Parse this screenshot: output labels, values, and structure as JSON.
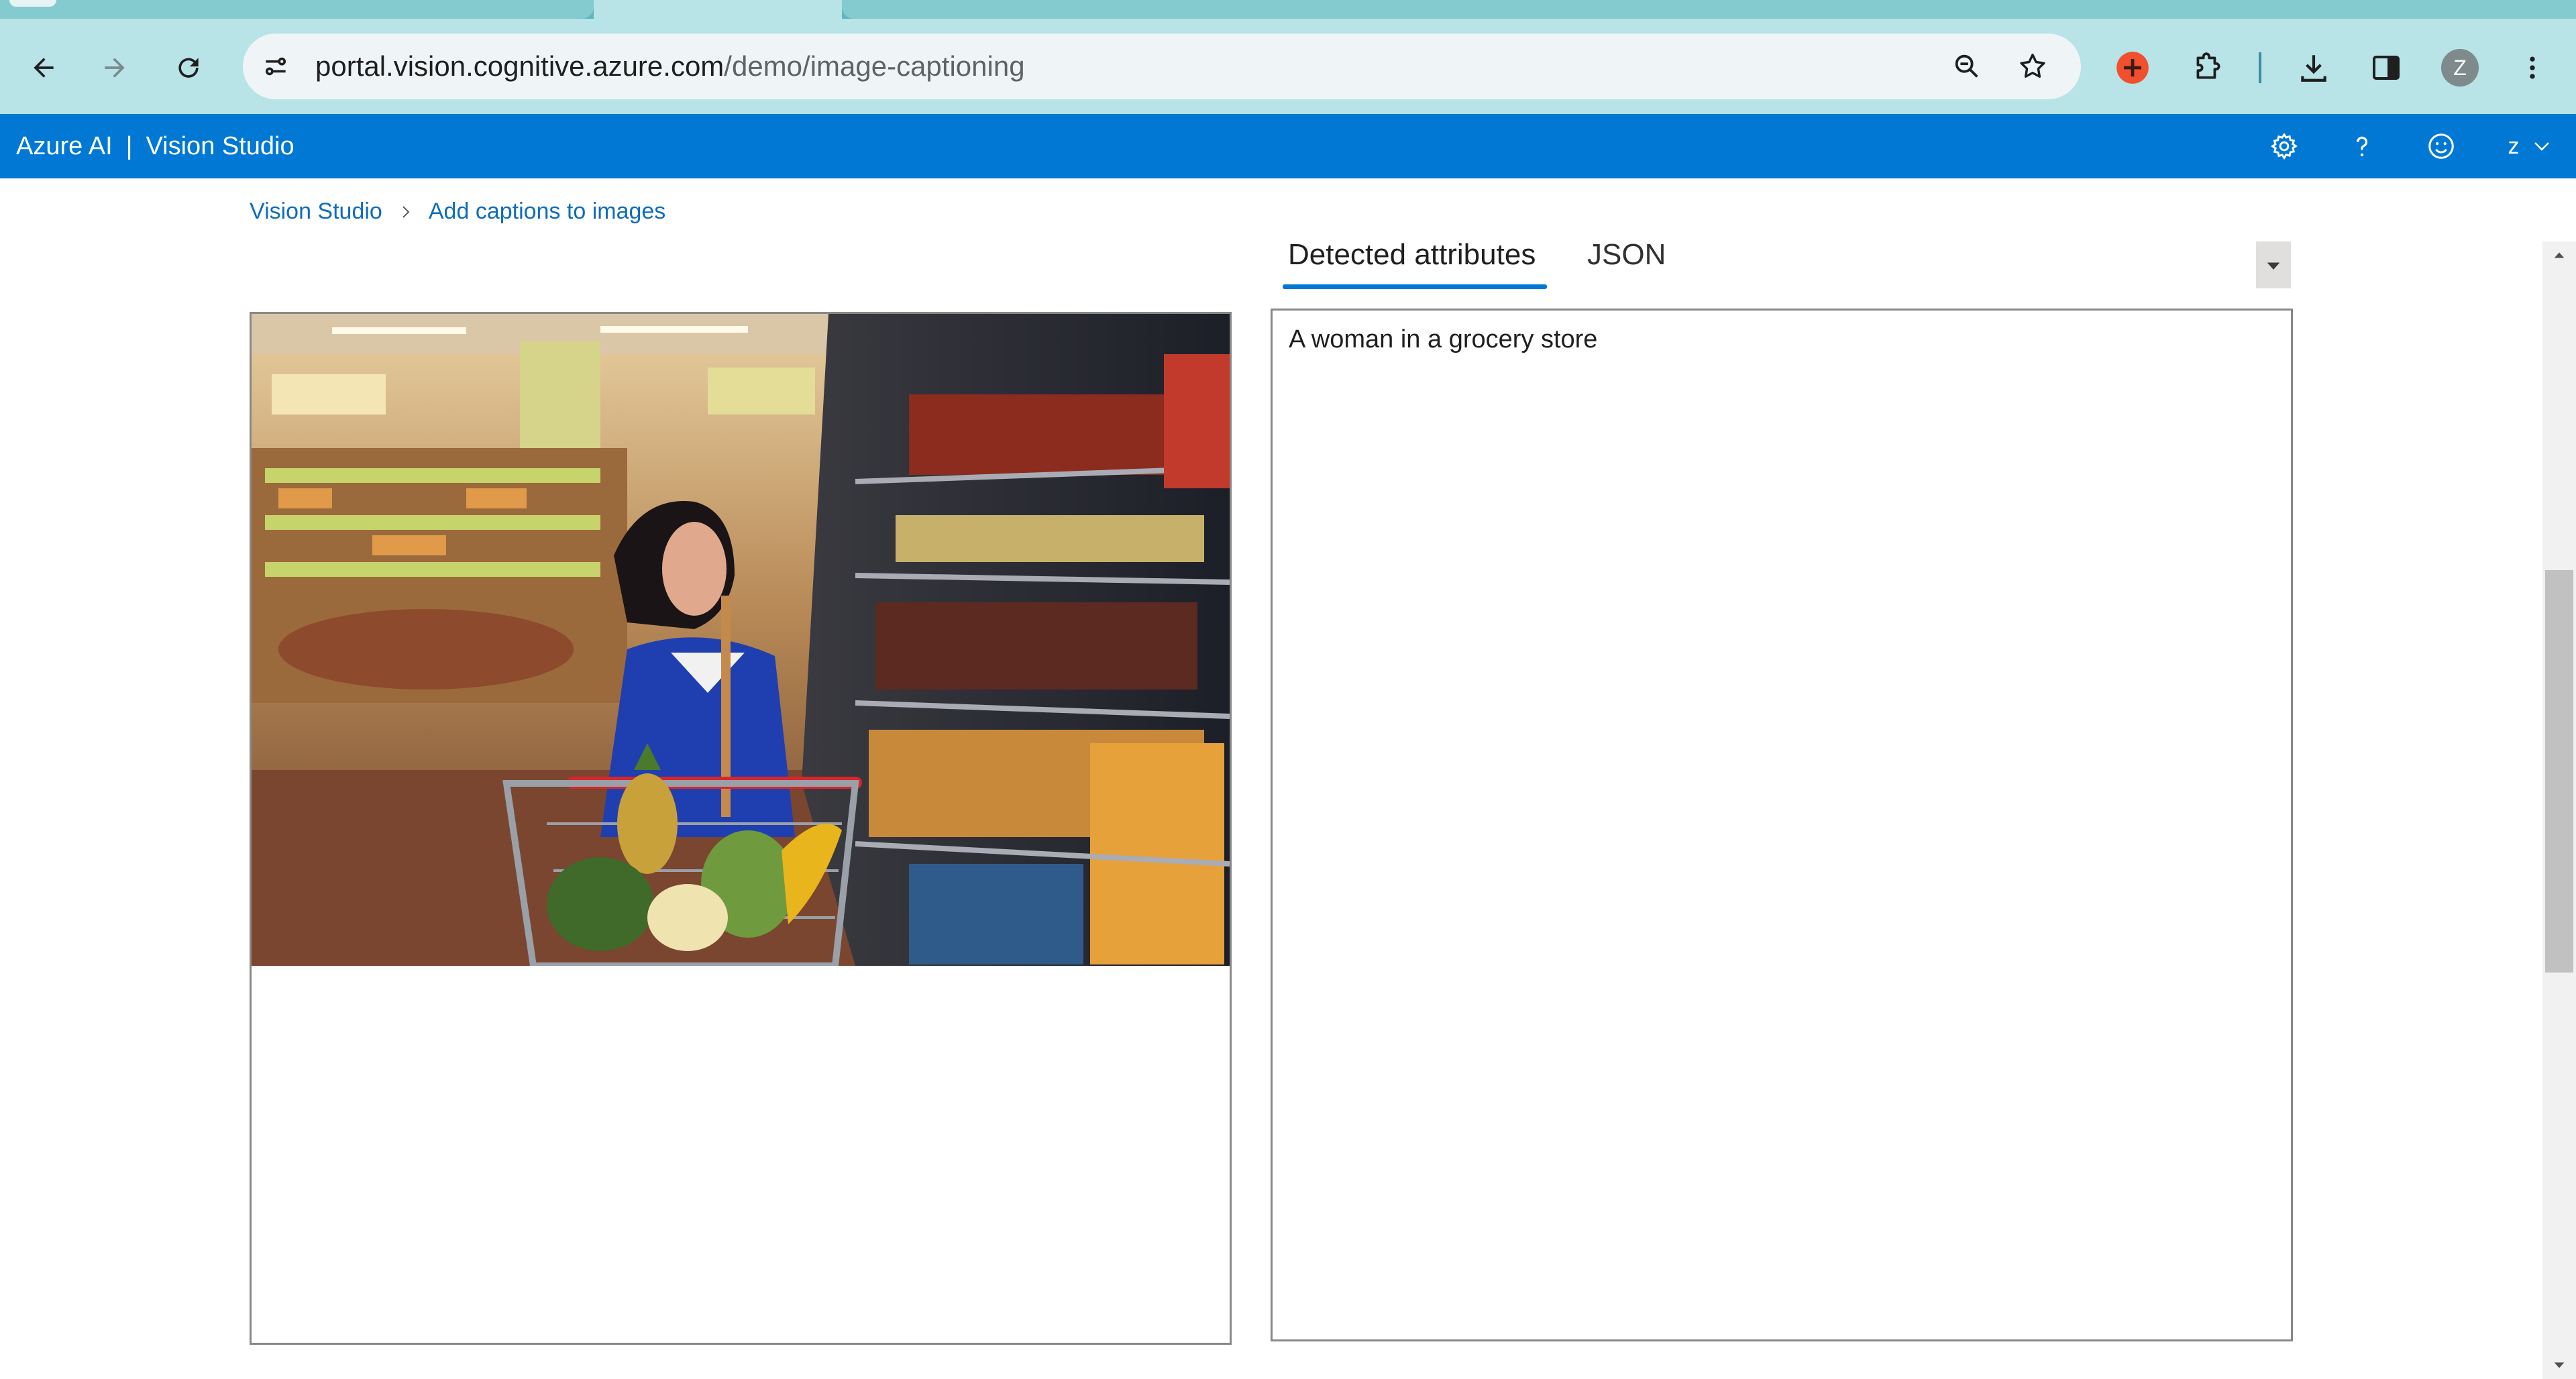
{
  "browser": {
    "url_host": "portal.vision.cognitive.azure.com",
    "url_path": "/demo/image-captioning",
    "profile_initial": "Z"
  },
  "header": {
    "product": "Azure AI",
    "separator": "|",
    "app": "Vision Studio",
    "user_initial": "z"
  },
  "breadcrumb": {
    "items": [
      "Vision Studio",
      "Add captions to images"
    ]
  },
  "result_tabs": [
    {
      "label": "Detected attributes",
      "selected": true
    },
    {
      "label": "JSON",
      "selected": false
    }
  ],
  "result": {
    "caption": "A woman in a grocery store"
  },
  "colors": {
    "azure_blue": "#0078d4",
    "link": "#0f6cbd",
    "chrome_toolbar": "#b8e3e7",
    "extension_red": "#f0502d"
  }
}
